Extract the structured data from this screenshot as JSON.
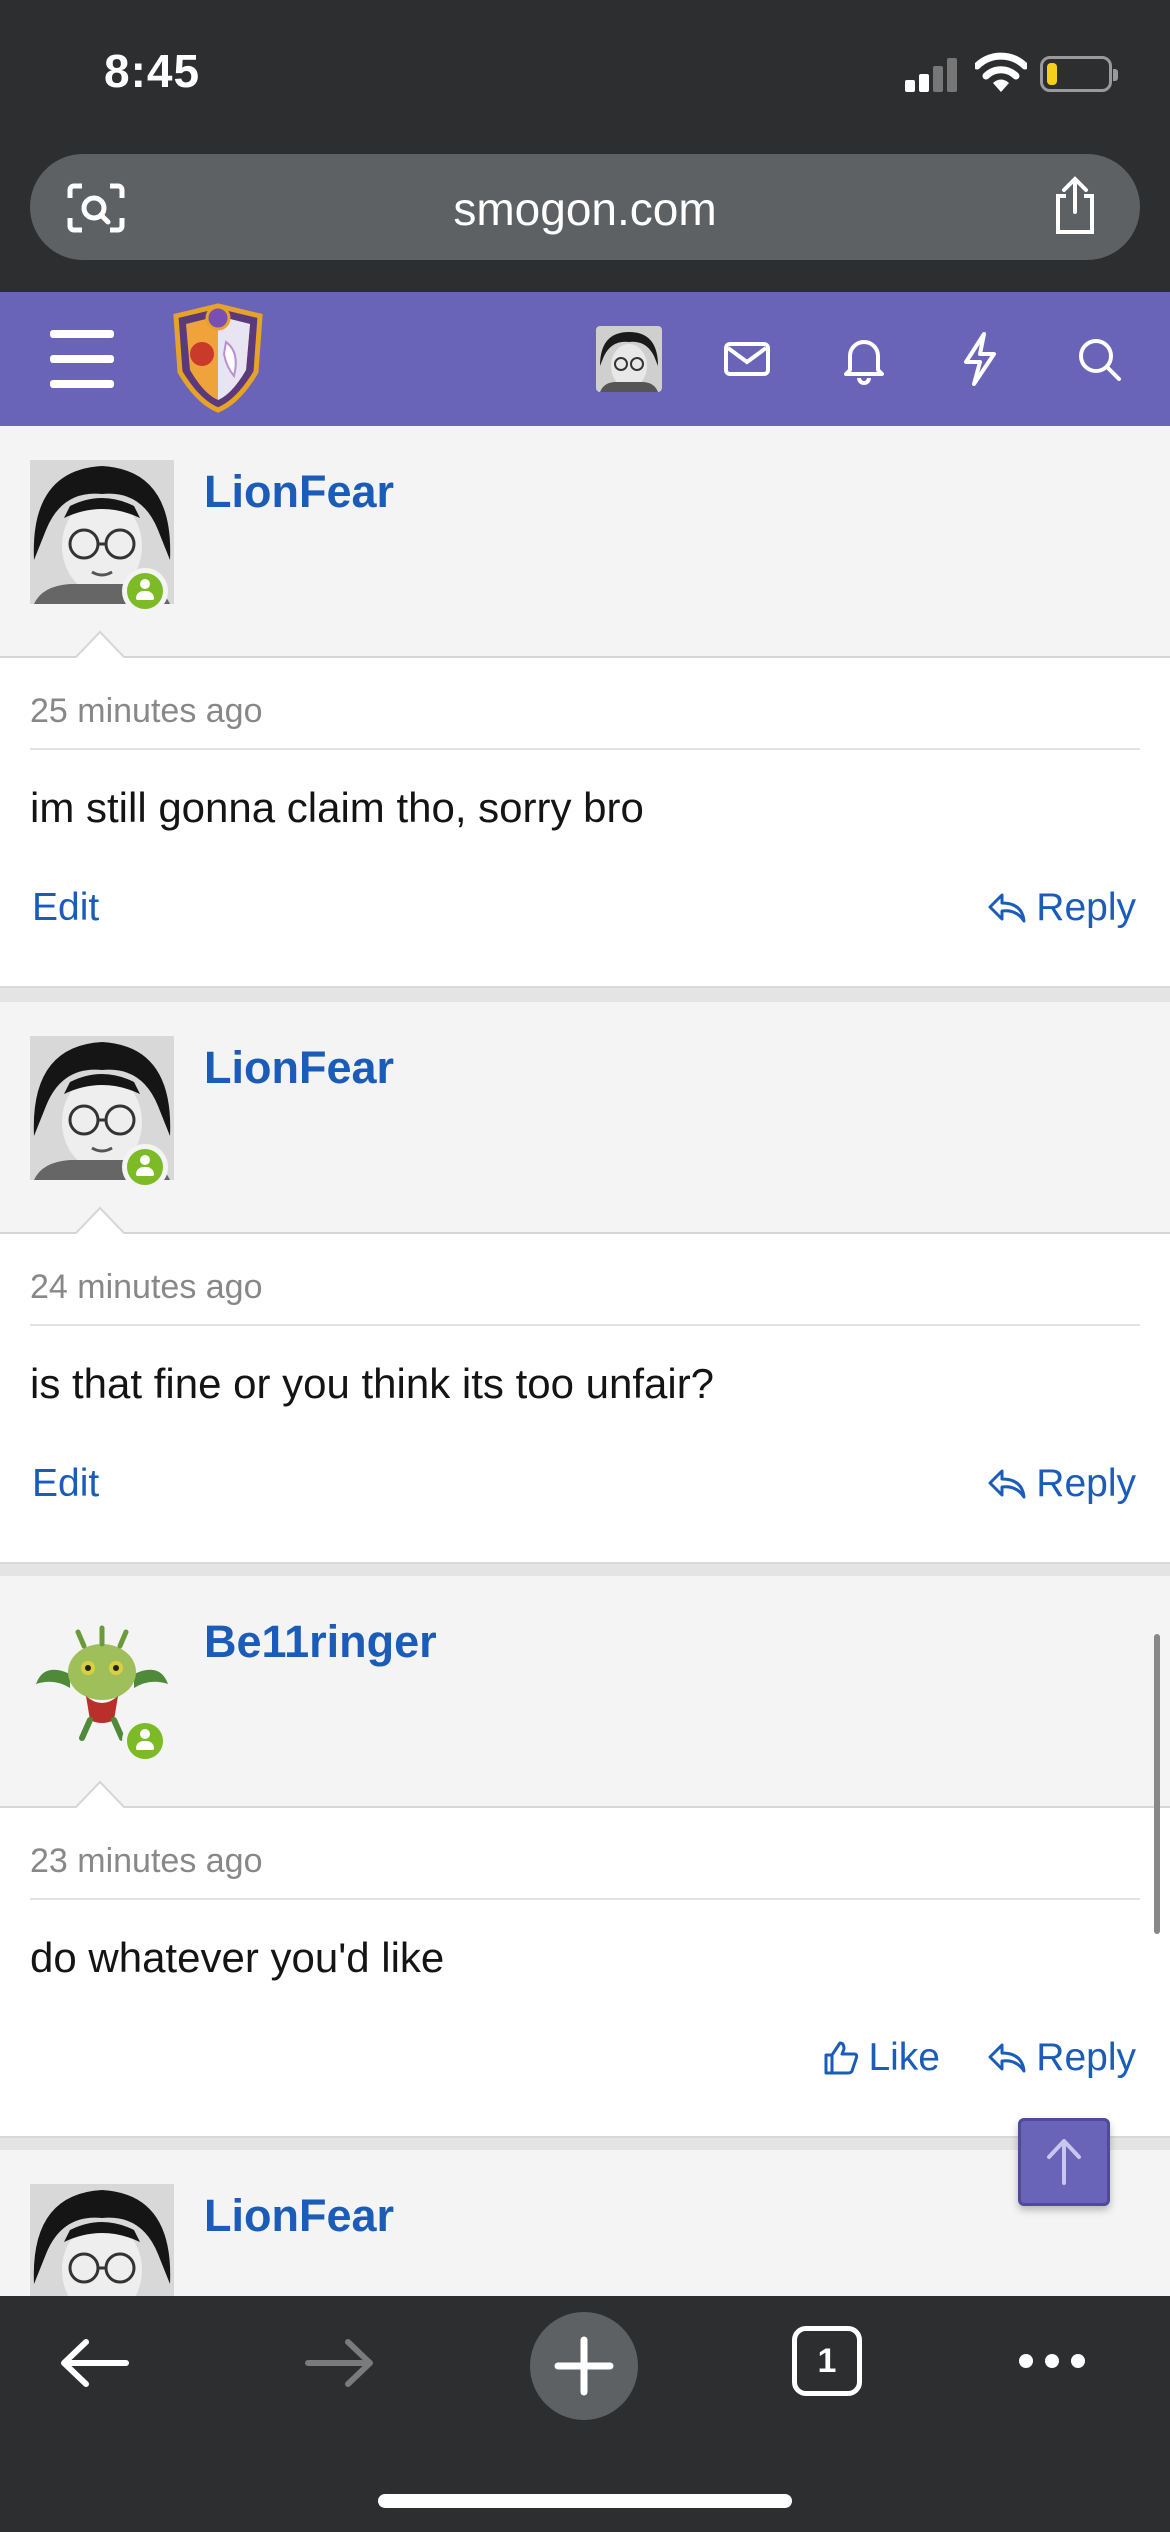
{
  "status_bar": {
    "time": "8:45"
  },
  "browser": {
    "url": "smogon.com",
    "tab_count": "1"
  },
  "posts": [
    {
      "username": "LionFear",
      "time": "25 minutes ago",
      "text": "im still gonna claim tho, sorry bro",
      "left_action": "Edit",
      "reply": "Reply"
    },
    {
      "username": "LionFear",
      "time": "24 minutes ago",
      "text": "is that fine or you think its too unfair?",
      "left_action": "Edit",
      "reply": "Reply"
    },
    {
      "username": "Be11ringer",
      "time": "23 minutes ago",
      "text": "do whatever you'd like",
      "like": "Like",
      "reply": "Reply"
    },
    {
      "username": "LionFear"
    }
  ],
  "colors": {
    "header": "#6a64b8",
    "link": "#1a5cb8",
    "online": "#7cba26",
    "chrome": "#2d2e30"
  }
}
